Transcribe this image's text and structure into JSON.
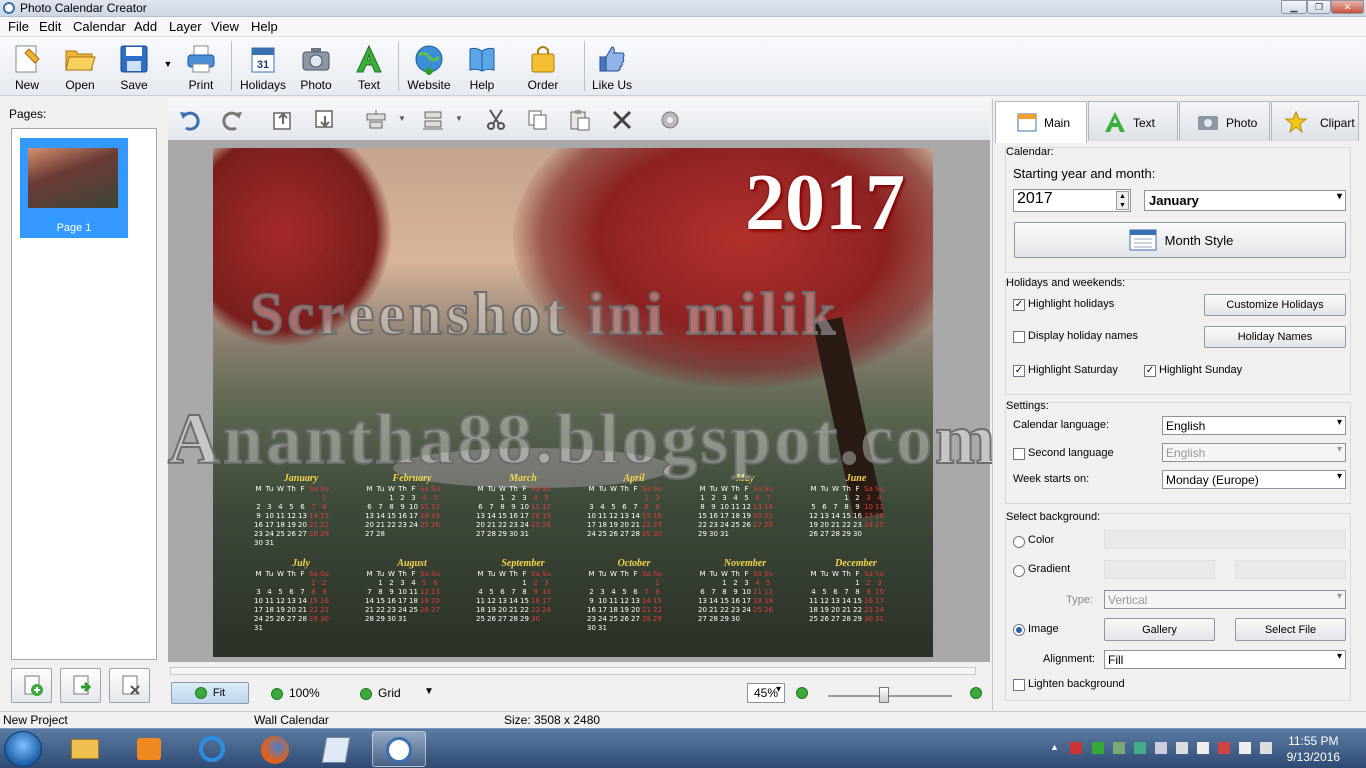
{
  "window": {
    "title": "Photo Calendar Creator"
  },
  "menu": [
    "File",
    "Edit",
    "Calendar",
    "Add",
    "Layer",
    "View",
    "Help"
  ],
  "toolbar": {
    "items": [
      {
        "label": "New",
        "icon": "new-icon"
      },
      {
        "label": "Open",
        "icon": "open-folder-icon"
      },
      {
        "label": "Save",
        "icon": "save-icon"
      },
      {
        "label": "Print",
        "icon": "print-icon"
      },
      {
        "label": "Holidays",
        "icon": "holidays-calendar-icon"
      },
      {
        "label": "Photo",
        "icon": "camera-icon"
      },
      {
        "label": "Text",
        "icon": "text-a-icon"
      },
      {
        "label": "Website",
        "icon": "globe-icon"
      },
      {
        "label": "Help",
        "icon": "book-icon"
      },
      {
        "label": "Order",
        "icon": "shopping-bag-icon"
      },
      {
        "label": "Like Us",
        "icon": "thumbs-up-icon"
      }
    ]
  },
  "pages": {
    "label": "Pages:",
    "items": [
      {
        "name": "Page 1"
      }
    ]
  },
  "poster": {
    "year": "2017",
    "weekday_header": [
      "M",
      "Tu",
      "W",
      "Th",
      "F",
      "Sa",
      "Su"
    ],
    "months": [
      {
        "name": "January",
        "offset": 6,
        "days": 31
      },
      {
        "name": "February",
        "offset": 2,
        "days": 28
      },
      {
        "name": "March",
        "offset": 2,
        "days": 31
      },
      {
        "name": "April",
        "offset": 5,
        "days": 30
      },
      {
        "name": "May",
        "offset": 0,
        "days": 31
      },
      {
        "name": "June",
        "offset": 3,
        "days": 30
      },
      {
        "name": "July",
        "offset": 5,
        "days": 31
      },
      {
        "name": "August",
        "offset": 1,
        "days": 31
      },
      {
        "name": "September",
        "offset": 4,
        "days": 30
      },
      {
        "name": "October",
        "offset": 6,
        "days": 31
      },
      {
        "name": "November",
        "offset": 2,
        "days": 30
      },
      {
        "name": "December",
        "offset": 4,
        "days": 31
      }
    ]
  },
  "watermark": {
    "line1": "Screenshot ini milik",
    "line2": "Anantha88.blogspot.com"
  },
  "view": {
    "fit": "Fit",
    "zoom100": "100%",
    "grid": "Grid",
    "zoom_value": "45%",
    "zoom_level": 0.45
  },
  "tabs": [
    {
      "label": "Main"
    },
    {
      "label": "Text"
    },
    {
      "label": "Photo"
    },
    {
      "label": "Clipart"
    }
  ],
  "calendar": {
    "group": "Calendar:",
    "start_label": "Starting year and month:",
    "year": "2017",
    "month": "January",
    "month_style": "Month Style"
  },
  "holidays": {
    "group": "Holidays and weekends:",
    "highlight_holidays": "Highlight holidays",
    "display_names": "Display holiday names",
    "highlight_saturday": "Highlight Saturday",
    "highlight_sunday": "Highlight Sunday",
    "customize": "Customize Holidays",
    "names_button": "Holiday Names"
  },
  "settings": {
    "group": "Settings:",
    "lang_label": "Calendar language:",
    "lang": "English",
    "second_label": "Second language",
    "second": "English",
    "week_label": "Week starts on:",
    "week": "Monday (Europe)"
  },
  "background": {
    "group": "Select background:",
    "color": "Color",
    "gradient": "Gradient",
    "type_label": "Type:",
    "type": "Vertical",
    "image": "Image",
    "gallery": "Gallery",
    "select_file": "Select File",
    "align_label": "Alignment:",
    "align": "Fill",
    "lighten": "Lighten background"
  },
  "status": {
    "project": "New Project",
    "type": "Wall Calendar",
    "size": "Size: 3508 x 2480"
  },
  "clock": {
    "time": "11:55 PM",
    "date": "9/13/2016"
  }
}
